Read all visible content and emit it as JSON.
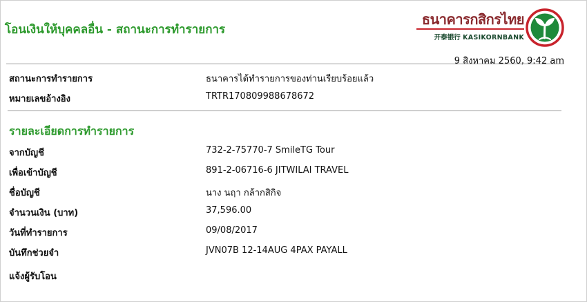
{
  "header": {
    "title": "โอนเงินให้บุคคลอื่น - สถานะการทำรายการ"
  },
  "brand": {
    "name_thai": "ธนาคารกสิกรไทย",
    "name_chinese": "开泰银行",
    "name_english": "KASIKORNBANK",
    "logo_icon": "kasikorn-leaf-logo",
    "colors": {
      "green": "#2e9a2e",
      "dark_green": "#1b4a2f",
      "red": "#c8232c",
      "maroon": "#8a2a2e"
    }
  },
  "datetime": "9 สิงหาคม 2560, 9:42 am",
  "status": {
    "label": "สถานะการทำรายการ",
    "value": "ธนาคารได้ทำรายการของท่านเรียบร้อยแล้ว"
  },
  "reference": {
    "label": "หมายเลขอ้างอิง",
    "value": "TRTR170809988678672"
  },
  "details": {
    "section_title": "รายละเอียดการทำรายการ",
    "rows": [
      {
        "label": "จากบัญชี",
        "value": "732-2-75770-7 SmileTG Tour"
      },
      {
        "label": "เพื่อเข้าบัญชี",
        "value": "891-2-06716-6 JITWILAI TRAVEL"
      },
      {
        "label": "ชื่อบัญชี",
        "value": "นาง นฤา กล้ากสิกิจ"
      },
      {
        "label": "จำนวนเงิน (บาท)",
        "value": "37,596.00"
      },
      {
        "label": "วันที่ทำรายการ",
        "value": "09/08/2017"
      },
      {
        "label": "บันทึกช่วยจำ",
        "value": "JVN07B 12-14AUG 4PAX PAYALL"
      }
    ],
    "notify_label": "แจ้งผู้รับโอน"
  }
}
